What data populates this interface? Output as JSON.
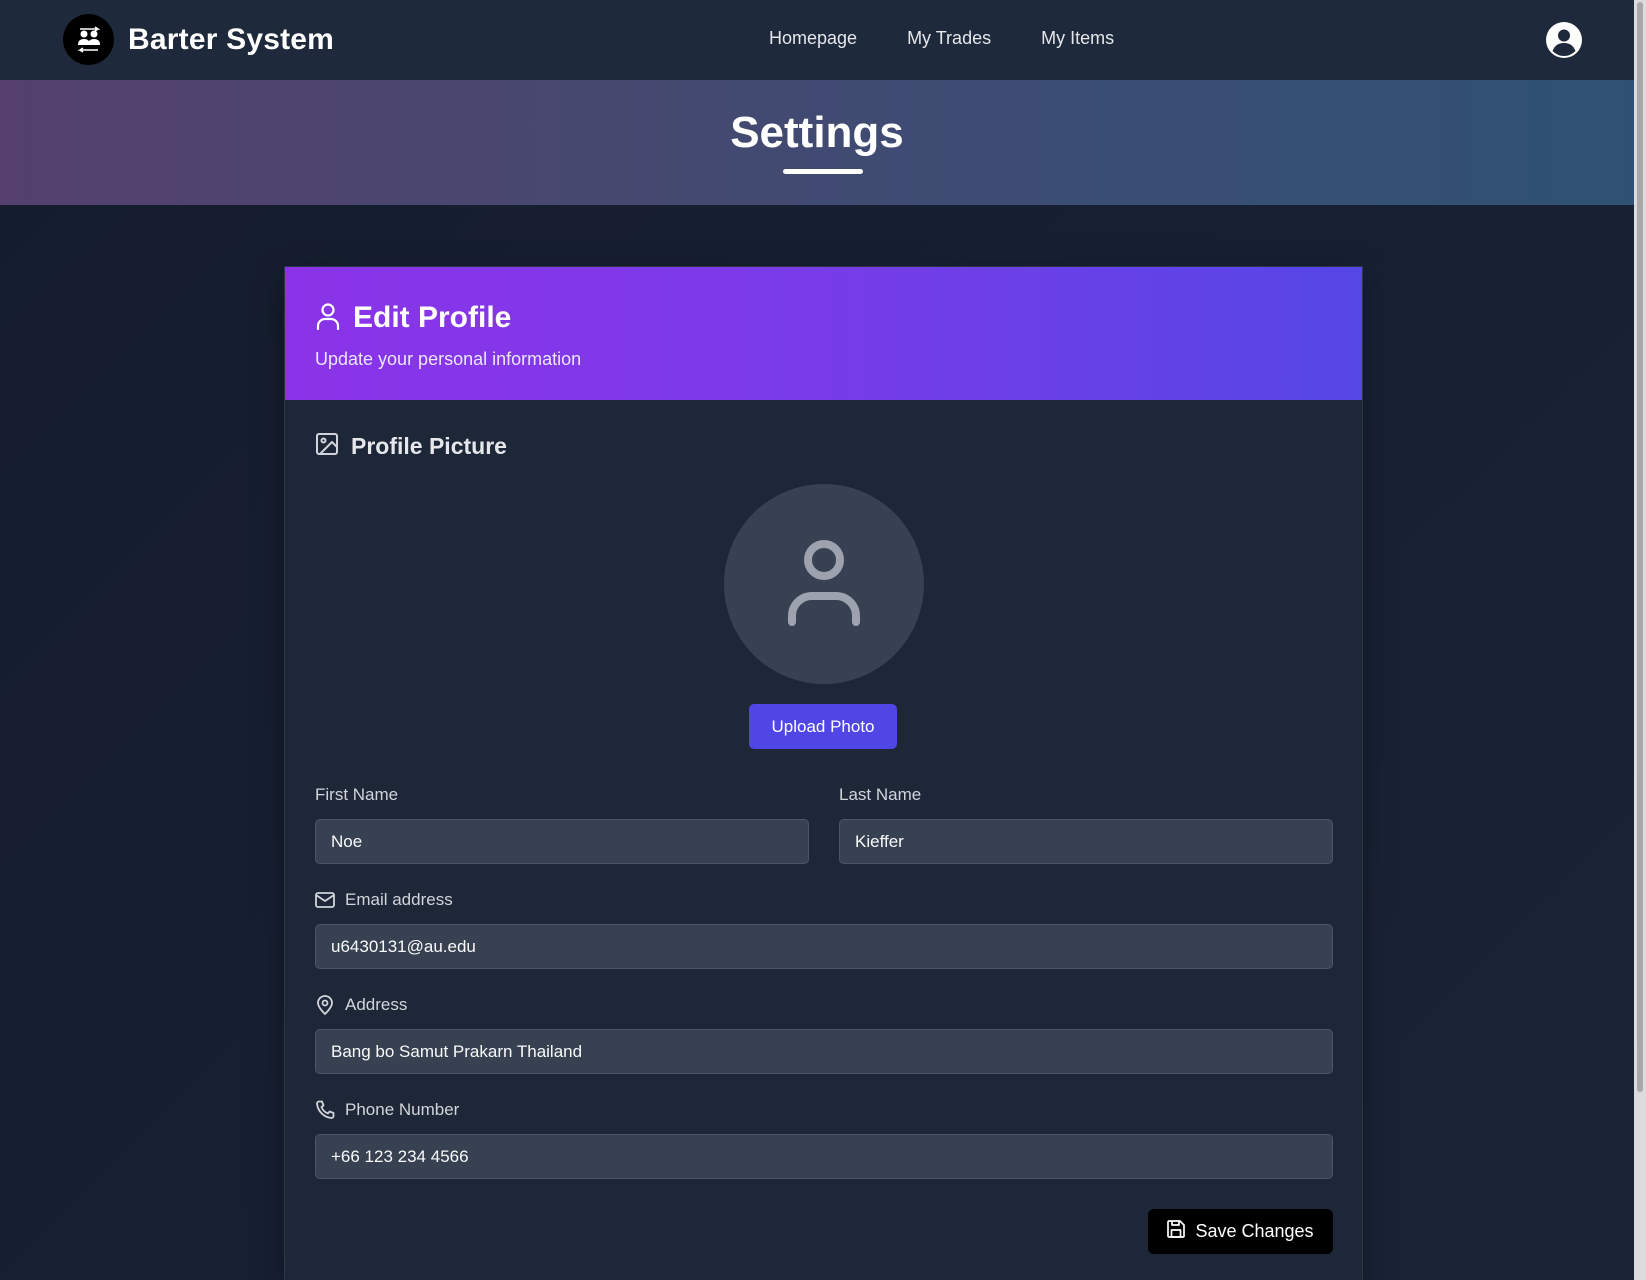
{
  "brand": {
    "name": "Barter System",
    "logo_icon": "barter-people-icon"
  },
  "nav": {
    "links": [
      "Homepage",
      "My Trades",
      "My Items"
    ],
    "user_icon": "user-circle-icon"
  },
  "banner": {
    "title": "Settings"
  },
  "card": {
    "title": "Edit Profile",
    "subtitle": "Update your personal information",
    "title_icon": "user-icon"
  },
  "profile_picture": {
    "title": "Profile Picture",
    "icon": "image-icon",
    "avatar_icon": "user-placeholder-icon",
    "upload_label": "Upload Photo"
  },
  "form": {
    "first_name": {
      "label": "First Name",
      "value": "Noe"
    },
    "last_name": {
      "label": "Last Name",
      "value": "Kieffer"
    },
    "email": {
      "label": "Email address",
      "value": "u6430131@au.edu",
      "icon": "mail-icon"
    },
    "address": {
      "label": "Address",
      "value": "Bang bo Samut Prakarn Thailand",
      "icon": "map-pin-icon"
    },
    "phone": {
      "label": "Phone Number",
      "value": "+66 123 234 4566",
      "icon": "phone-icon"
    }
  },
  "save": {
    "label": "Save Changes",
    "icon": "save-icon"
  },
  "colors": {
    "nav_bg": "#1e293b",
    "card_header_start": "#8b33e8",
    "card_header_end": "#5546e6",
    "primary_button": "#4f46e5",
    "save_button": "#000000"
  }
}
